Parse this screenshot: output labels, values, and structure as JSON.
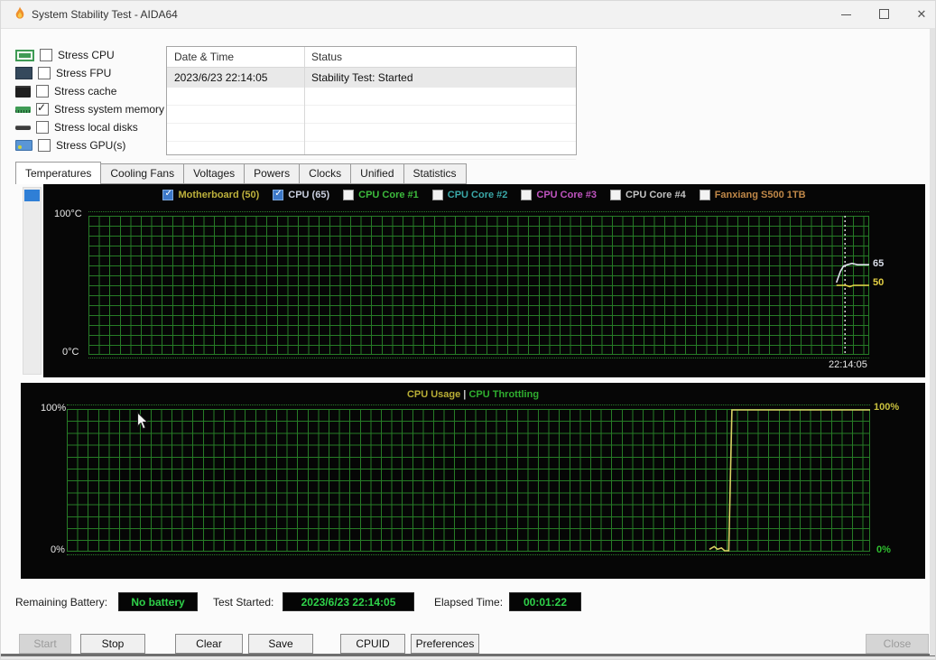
{
  "window": {
    "title": "System Stability Test - AIDA64",
    "titlebar_icon": "flame-icon",
    "controls": [
      "minimize-icon",
      "maximize-icon",
      "close-icon"
    ]
  },
  "stress": {
    "options": [
      {
        "label": "Stress CPU",
        "checked": false,
        "icon": "cpu-icon"
      },
      {
        "label": "Stress FPU",
        "checked": false,
        "icon": "fpu-icon"
      },
      {
        "label": "Stress cache",
        "checked": false,
        "icon": "cache-icon"
      },
      {
        "label": "Stress system memory",
        "checked": true,
        "icon": "memory-icon"
      },
      {
        "label": "Stress local disks",
        "checked": false,
        "icon": "disk-icon"
      },
      {
        "label": "Stress GPU(s)",
        "checked": false,
        "icon": "gpu-icon"
      }
    ]
  },
  "log": {
    "columns": [
      "Date & Time",
      "Status"
    ],
    "rows": [
      {
        "datetime": "2023/6/23 22:14:05",
        "status": "Stability Test: Started",
        "selected": true
      }
    ],
    "empty_row_count": 4
  },
  "tabs": {
    "items": [
      "Temperatures",
      "Cooling Fans",
      "Voltages",
      "Powers",
      "Clocks",
      "Unified",
      "Statistics"
    ],
    "active": "Temperatures"
  },
  "chart_data": [
    {
      "id": "temperatures",
      "type": "line",
      "ylim": [
        0,
        100
      ],
      "ylabels": {
        "top": "100°C",
        "bottom": "0°C"
      },
      "x_end_label": "22:14:05",
      "grid_color": "#267c26",
      "start_marker_xf": 0.969,
      "legend": [
        {
          "label": "Motherboard (50)",
          "checked": true,
          "color": "#bdb13c"
        },
        {
          "label": "CPU (65)",
          "checked": true,
          "color": "#c9cfdf"
        },
        {
          "label": "CPU Core #1",
          "checked": false,
          "color": "#3dbb3d"
        },
        {
          "label": "CPU Core #2",
          "checked": false,
          "color": "#3aa8a8"
        },
        {
          "label": "CPU Core #3",
          "checked": false,
          "color": "#c054c0"
        },
        {
          "label": "CPU Core #4",
          "checked": false,
          "color": "#c2c2c2"
        },
        {
          "label": "Fanxiang S500 1TB",
          "checked": false,
          "color": "#c08848"
        }
      ],
      "right_value_labels": [
        {
          "text": "65",
          "color": "#d9dde8"
        },
        {
          "text": "50",
          "color": "#e3cf44"
        }
      ],
      "series": [
        {
          "name": "CPU",
          "color": "#dfe2ec",
          "current": 65,
          "points": [
            [
              0.958,
              52
            ],
            [
              0.963,
              60
            ],
            [
              0.967,
              64
            ],
            [
              0.972,
              65
            ],
            [
              0.978,
              66
            ],
            [
              0.985,
              65
            ],
            [
              1,
              65
            ]
          ]
        },
        {
          "name": "Motherboard",
          "color": "#e3cf44",
          "current": 50,
          "points": [
            [
              0.958,
              50
            ],
            [
              0.97,
              50
            ],
            [
              0.975,
              49
            ],
            [
              0.98,
              50
            ],
            [
              1,
              50
            ]
          ]
        }
      ]
    },
    {
      "id": "cpu-usage",
      "type": "line",
      "ylim": [
        0,
        100
      ],
      "title_left": "CPU Usage",
      "title_sep": "|",
      "title_right": "CPU Throttling",
      "title_left_color": "#b8ae35",
      "title_right_color": "#2fae2f",
      "left_labels": {
        "top": "100%",
        "bottom": "0%"
      },
      "right_labels": {
        "top": "100%",
        "bottom": "0%"
      },
      "right_top_color": "#c9c13e",
      "right_bottom_color": "#2fbf2f",
      "grid_color": "#267c26",
      "series": [
        {
          "name": "CPU Usage",
          "color": "#d9d264",
          "current": 100,
          "points": [
            [
              0.8,
              1
            ],
            [
              0.806,
              3
            ],
            [
              0.81,
              1
            ],
            [
              0.815,
              2
            ],
            [
              0.819,
              0
            ],
            [
              0.824,
              0
            ],
            [
              0.828,
              100
            ],
            [
              1,
              100
            ]
          ]
        }
      ]
    }
  ],
  "status_bar": {
    "battery_label": "Remaining Battery:",
    "battery_value": "No battery",
    "started_label": "Test Started:",
    "started_value": "2023/6/23 22:14:05",
    "elapsed_label": "Elapsed Time:",
    "elapsed_value": "00:01:22",
    "value_color": "#2fd24a"
  },
  "footer": {
    "buttons": [
      {
        "label": "Start",
        "enabled": false
      },
      {
        "label": "Stop",
        "enabled": true
      },
      {
        "label": "Clear",
        "enabled": true
      },
      {
        "label": "Save",
        "enabled": true
      },
      {
        "label": "CPUID",
        "enabled": true
      },
      {
        "label": "Preferences",
        "enabled": true
      },
      {
        "label": "Close",
        "enabled": false
      }
    ]
  }
}
